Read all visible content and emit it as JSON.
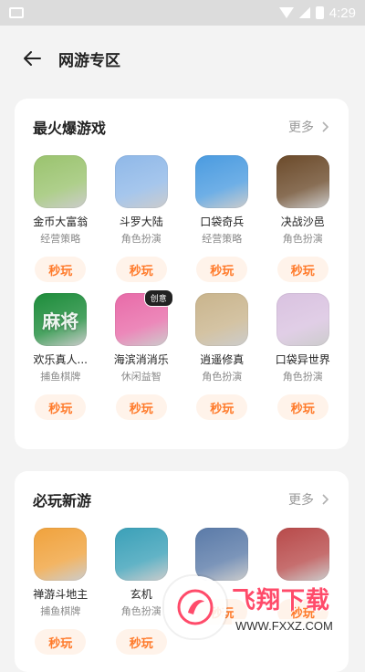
{
  "status_bar": {
    "time": "4:29"
  },
  "header": {
    "title": "网游专区"
  },
  "sections": [
    {
      "title": "最火爆游戏",
      "more": "更多",
      "games": [
        {
          "name": "金币大富翁",
          "category": "经营策略",
          "button": "秒玩",
          "icon": "mansion-icon",
          "color": "#9ac36e"
        },
        {
          "name": "斗罗大陆",
          "category": "角色扮演",
          "button": "秒玩",
          "icon": "anime-duo-icon",
          "color": "#8fb8e8"
        },
        {
          "name": "口袋奇兵",
          "category": "经营策略",
          "button": "秒玩",
          "icon": "soldier-icon",
          "color": "#4a9be0"
        },
        {
          "name": "决战沙邑",
          "category": "角色扮演",
          "button": "秒玩",
          "icon": "warrior-icon",
          "color": "#6b4a2a"
        },
        {
          "name": "欢乐真人...",
          "category": "捕鱼棋牌",
          "button": "秒玩",
          "icon": "mahjong-icon",
          "color": "#1c8c3a",
          "glyph": "麻将"
        },
        {
          "name": "海滨消消乐",
          "category": "休闲益智",
          "button": "秒玩",
          "icon": "candy-icon",
          "color": "#e86aa8",
          "badge": "创意"
        },
        {
          "name": "逍遥修真",
          "category": "角色扮演",
          "button": "秒玩",
          "icon": "swordsman-icon",
          "color": "#c9b48c"
        },
        {
          "name": "口袋异世界",
          "category": "角色扮演",
          "button": "秒玩",
          "icon": "anime-girl-icon",
          "color": "#d9c2e0"
        }
      ]
    },
    {
      "title": "必玩新游",
      "more": "更多",
      "games": [
        {
          "name": "禅游斗地主",
          "category": "捕鱼棋牌",
          "button": "秒玩",
          "icon": "landlord-icon",
          "color": "#f0a23c"
        },
        {
          "name": "玄机",
          "category": "角色扮演",
          "button": "秒玩",
          "icon": "punk-boy-icon",
          "color": "#3aa0b8"
        },
        {
          "name": "",
          "category": "",
          "button": "秒玩",
          "icon": "squad-icon",
          "color": "#5a7aa8"
        },
        {
          "name": "",
          "category": "",
          "button": "秒玩",
          "icon": "fighter-girl-icon",
          "color": "#b84a4a"
        }
      ]
    }
  ],
  "watermark": {
    "title": "飞翔下载",
    "url": "WWW.FXXZ.COM"
  }
}
